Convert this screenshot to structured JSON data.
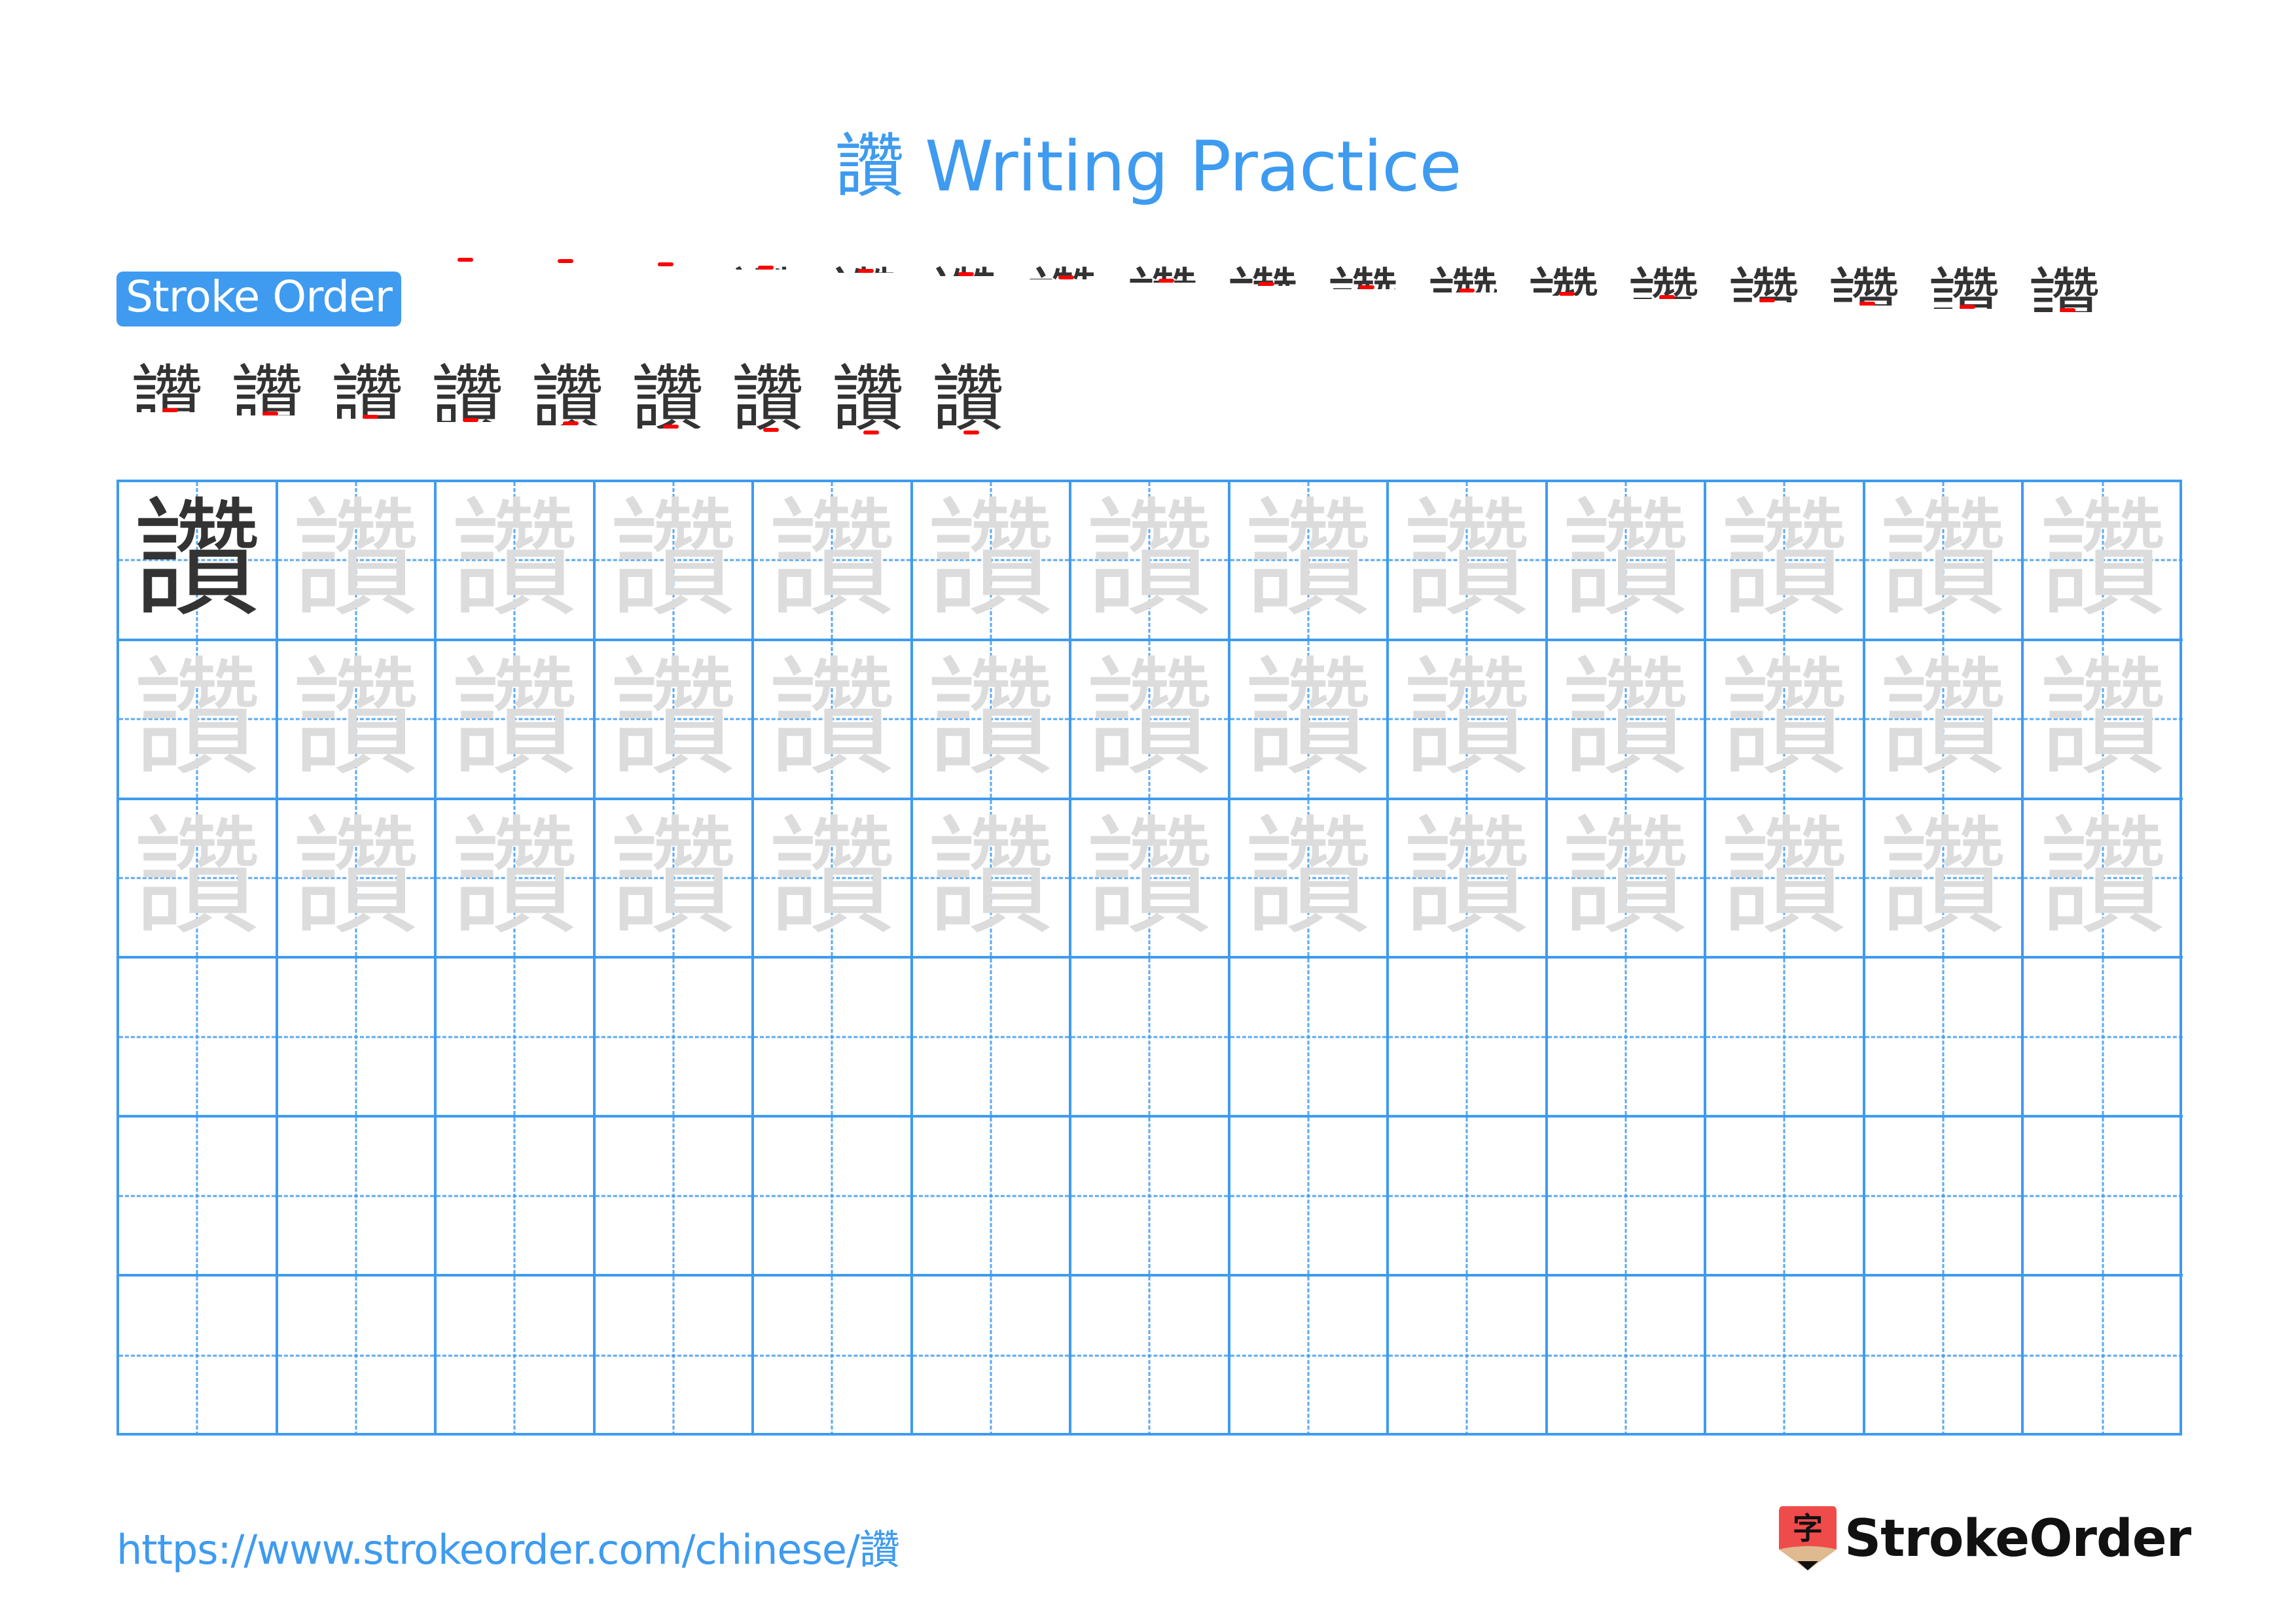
{
  "header": {
    "character": "讚",
    "title": "讚 Writing Practice",
    "title_color": "#3e9bf0"
  },
  "stroke_order": {
    "label": "Stroke Order",
    "total_strokes": 26,
    "highlight_color": "#ff0000",
    "base_color": "#333333",
    "steps": [
      1,
      2,
      3,
      4,
      5,
      6,
      7,
      8,
      9,
      10,
      11,
      12,
      13,
      14,
      15,
      16,
      17,
      18,
      19,
      20,
      21,
      22,
      23,
      24,
      25,
      26
    ]
  },
  "practice_grid": {
    "columns": 13,
    "rows": 6,
    "model_character": "讚",
    "trace_character": "讚",
    "model_color": "#333333",
    "trace_color": "#dcdcdc",
    "line_color": "#3e9bf0",
    "rows_content": [
      "model+trace",
      "trace",
      "trace",
      "empty",
      "empty",
      "empty"
    ]
  },
  "footer": {
    "url": "https://www.strokeorder.com/chinese/讚",
    "brand": "StrokeOrder",
    "logo_glyph": "字",
    "logo_color": "#ef4b4b",
    "logo_tip_color": "#dfb98f"
  }
}
